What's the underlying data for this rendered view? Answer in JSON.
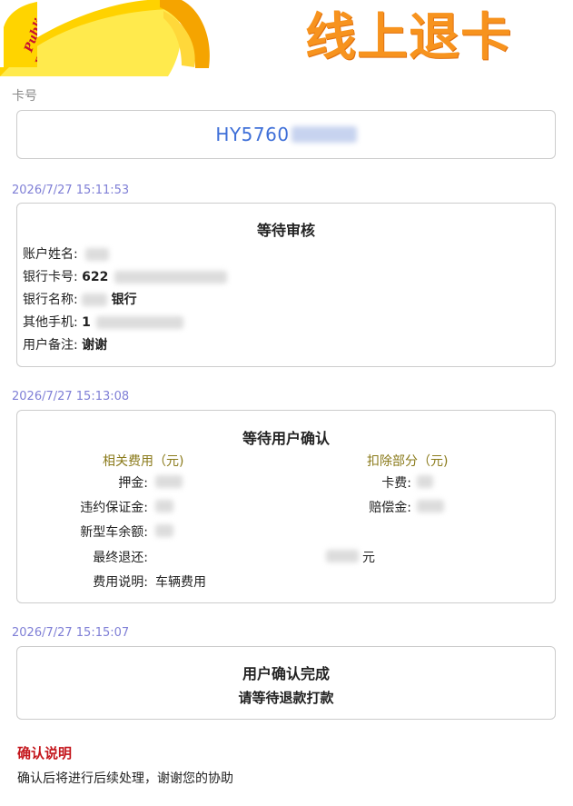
{
  "banner": {
    "title": "线上退卡",
    "logo_text": "Public Bike",
    "title_color": "#f7931e"
  },
  "card": {
    "label": "卡号",
    "number_visible": "HY5760",
    "number_color": "#3e6fd8"
  },
  "steps": [
    {
      "timestamp": "2026/7/27 15:11:53",
      "title": "等待审核",
      "fields": [
        {
          "label": "账户姓名:",
          "value": ""
        },
        {
          "label": "银行卡号:",
          "value": "622"
        },
        {
          "label": "银行名称:",
          "value": "银行"
        },
        {
          "label": "其他手机:",
          "value": "1"
        },
        {
          "label": "用户备注:",
          "value": "谢谢"
        }
      ]
    },
    {
      "timestamp": "2026/7/27 15:13:08",
      "title": "等待用户确认",
      "fees_header": "相关费用（元)",
      "deduct_header": "扣除部分（元)",
      "deposit_label": "押金:",
      "penalty_label": "违约保证金:",
      "balance_label": "新型车余额:",
      "card_fee_label": "卡费:",
      "compensation_label": "赔偿金:",
      "final_refund_label": "最终退还:",
      "final_refund_unit": "元",
      "fee_desc_label": "费用说明:",
      "fee_desc_value": "车辆费用"
    },
    {
      "timestamp": "2026/7/27 15:15:07",
      "title": "用户确认完成",
      "subtitle": "请等待退款打款"
    }
  ],
  "confirm_note": {
    "title": "确认说明",
    "text": "确认后将进行后续处理，谢谢您的协助",
    "title_color": "#c4161c"
  }
}
